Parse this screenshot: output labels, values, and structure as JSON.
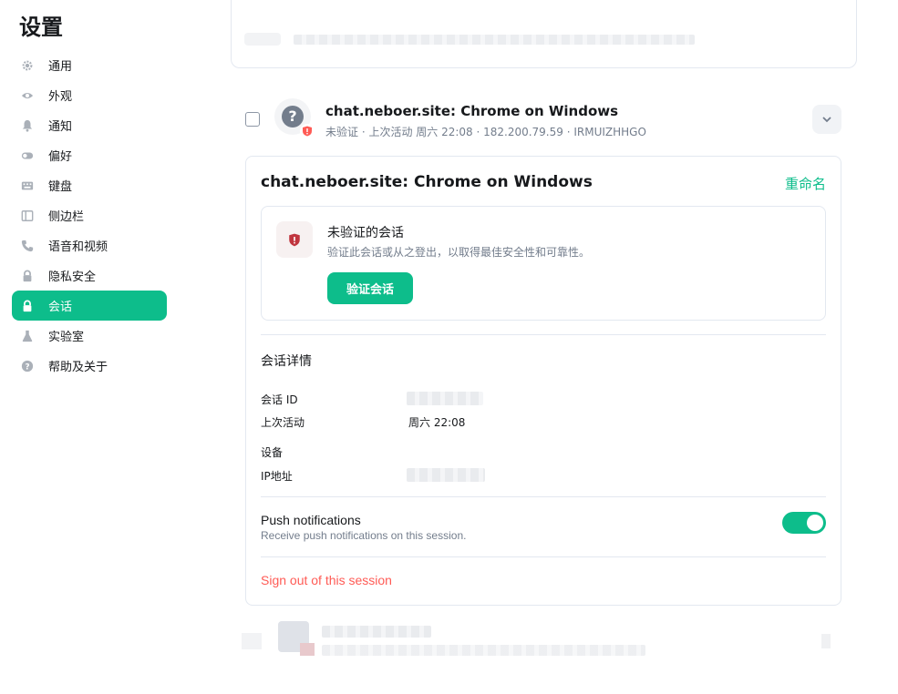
{
  "sidebar": {
    "title": "设置",
    "items": [
      {
        "label": "通用",
        "icon": "gear-icon"
      },
      {
        "label": "外观",
        "icon": "eye-icon"
      },
      {
        "label": "通知",
        "icon": "bell-icon"
      },
      {
        "label": "偏好",
        "icon": "toggle-icon"
      },
      {
        "label": "键盘",
        "icon": "keyboard-icon"
      },
      {
        "label": "侧边栏",
        "icon": "sidebar-icon"
      },
      {
        "label": "语音和视频",
        "icon": "phone-icon"
      },
      {
        "label": "隐私安全",
        "icon": "lock-icon"
      },
      {
        "label": "会话",
        "icon": "lock-icon",
        "active": true
      },
      {
        "label": "实验室",
        "icon": "flask-icon"
      },
      {
        "label": "帮助及关于",
        "icon": "help-icon"
      }
    ]
  },
  "session": {
    "title": "chat.neboer.site: Chrome on Windows",
    "meta": "未验证 · 上次活动 周六 22:08 · 182.200.79.59 · IRMUIZHHGO"
  },
  "detail": {
    "title": "chat.neboer.site: Chrome on Windows",
    "rename_label": "重命名",
    "warning": {
      "title": "未验证的会话",
      "description": "验证此会话或从之登出，以取得最佳安全性和可靠性。",
      "verify_label": "验证会话"
    },
    "section_title": "会话详情",
    "fields": {
      "session_id_label": "会话 ID",
      "last_activity_label": "上次活动",
      "last_activity_value": "周六 22:08",
      "device_label": "设备",
      "ip_label": "IP地址"
    },
    "push": {
      "title": "Push notifications",
      "description": "Receive push notifications on this session.",
      "enabled": true
    },
    "signout_label": "Sign out of this session"
  },
  "colors": {
    "accent": "#0dbd8b",
    "danger": "#ff5b55",
    "muted": "#737d8c"
  }
}
